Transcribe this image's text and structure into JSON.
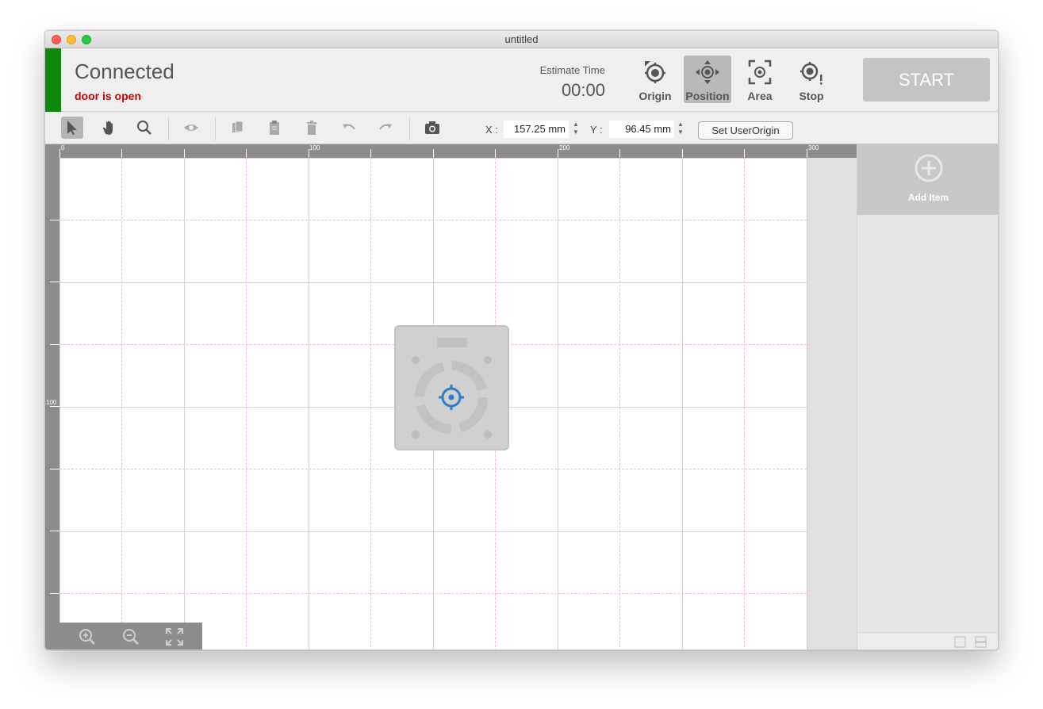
{
  "window": {
    "title": "untitled"
  },
  "header": {
    "connection_status": "Connected",
    "door_status": "door is open",
    "estimate_label": "Estimate Time",
    "estimate_value": "00:00",
    "tools": [
      {
        "label": "Origin",
        "icon": "origin-crosshair-icon",
        "active": false
      },
      {
        "label": "Position",
        "icon": "position-move-icon",
        "active": true
      },
      {
        "label": "Area",
        "icon": "area-frame-icon",
        "active": false
      },
      {
        "label": "Stop",
        "icon": "stop-crosshair-icon",
        "active": false
      }
    ],
    "start_label": "START",
    "colors": {
      "status_connected": "#0d8a0d",
      "door_warning": "#d00000"
    }
  },
  "toolbar": {
    "icons": [
      "select-arrow-icon",
      "hand-pan-icon",
      "zoom-magnifier-icon",
      "preview-eye-icon",
      "copy-icon",
      "paste-clipboard-icon",
      "delete-trash-icon",
      "undo-icon",
      "redo-icon",
      "camera-icon"
    ],
    "x_label": "X :",
    "x_value": "157.25 mm",
    "y_label": "Y :",
    "y_value": "96.45 mm",
    "set_origin_label": "Set UserOrigin"
  },
  "rulers": {
    "top_labels": [
      "0",
      "100",
      "200",
      "300"
    ],
    "left_labels": [
      "100"
    ]
  },
  "sidebar": {
    "add_item_label": "Add Item"
  }
}
